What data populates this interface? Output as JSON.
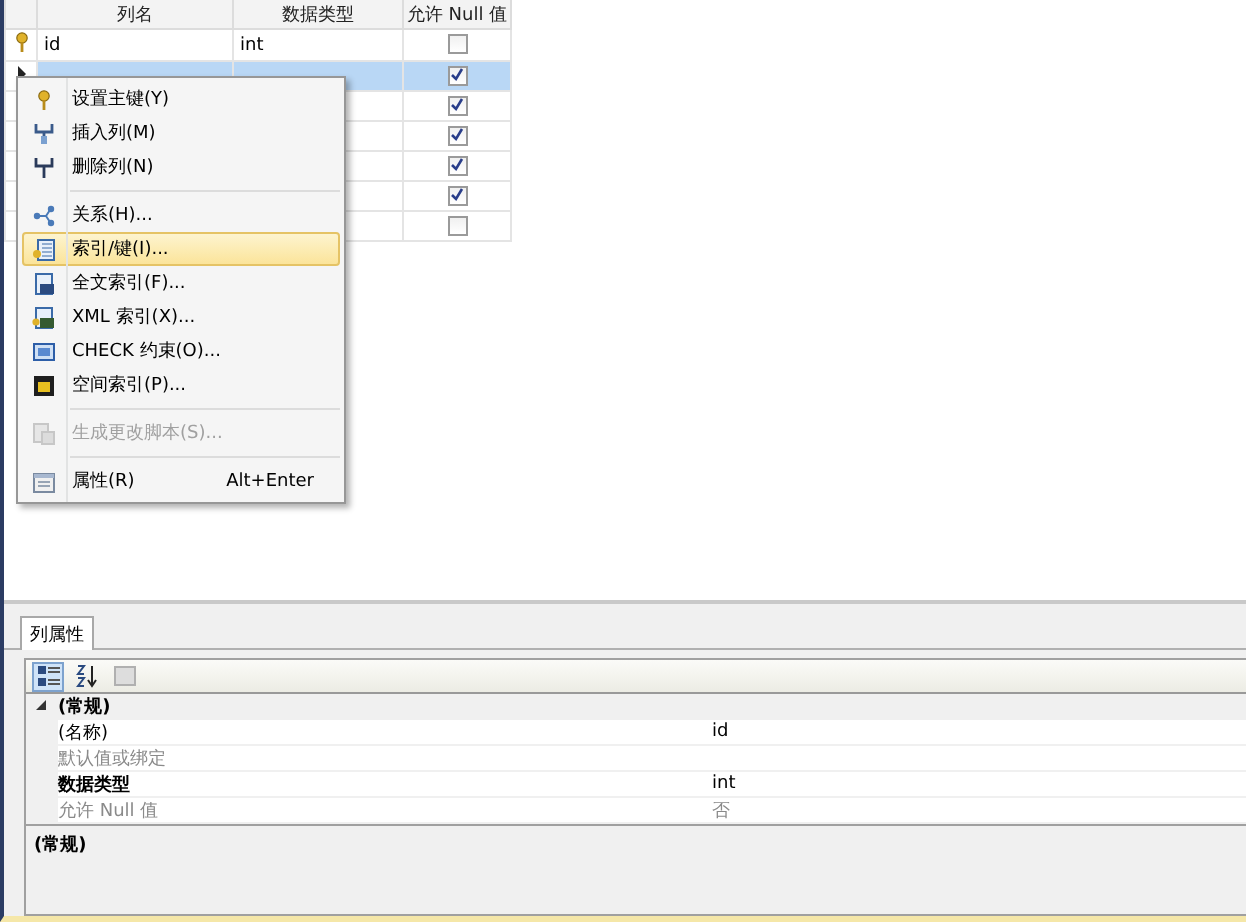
{
  "grid": {
    "columns": [
      "列名",
      "数据类型",
      "允许 Null 值"
    ],
    "rows": [
      {
        "name": "id",
        "type": "int",
        "allow_null": false,
        "selected": false,
        "primary_key": true,
        "current": false
      },
      {
        "allow_null": true,
        "selected": true,
        "primary_key": false,
        "current": true
      },
      {
        "allow_null": true,
        "selected": false,
        "primary_key": false,
        "current": false
      },
      {
        "allow_null": true,
        "selected": false,
        "primary_key": false,
        "current": false
      },
      {
        "allow_null": true,
        "selected": false,
        "primary_key": false,
        "current": false
      },
      {
        "allow_null": true,
        "selected": false,
        "primary_key": false,
        "current": false
      },
      {
        "allow_null": false,
        "selected": false,
        "primary_key": false,
        "current": false
      }
    ]
  },
  "context_menu": {
    "items": [
      {
        "kind": "item",
        "label": "设置主键(Y)",
        "disabled": false,
        "selected": false
      },
      {
        "kind": "item",
        "label": "插入列(M)",
        "disabled": false,
        "selected": false
      },
      {
        "kind": "item",
        "label": "删除列(N)",
        "disabled": false,
        "selected": false
      },
      {
        "kind": "separator"
      },
      {
        "kind": "item",
        "label": "关系(H)...",
        "disabled": false,
        "selected": false
      },
      {
        "kind": "item",
        "label": "索引/键(I)...",
        "disabled": false,
        "selected": true
      },
      {
        "kind": "item",
        "label": "全文索引(F)...",
        "disabled": false,
        "selected": false
      },
      {
        "kind": "item",
        "label": "XML 索引(X)...",
        "disabled": false,
        "selected": false
      },
      {
        "kind": "item",
        "label": "CHECK 约束(O)...",
        "disabled": false,
        "selected": false
      },
      {
        "kind": "item",
        "label": "空间索引(P)...",
        "disabled": false,
        "selected": false
      },
      {
        "kind": "separator"
      },
      {
        "kind": "item",
        "label": "生成更改脚本(S)...",
        "disabled": true,
        "selected": false
      },
      {
        "kind": "separator"
      },
      {
        "kind": "item",
        "label": "属性(R)",
        "shortcut": "Alt+Enter",
        "disabled": false,
        "selected": false
      }
    ]
  },
  "properties_panel": {
    "tab": "列属性",
    "category": {
      "label": "(常规)",
      "expanded": true
    },
    "rows": [
      {
        "name": "(名称)",
        "value": "id",
        "bold": false,
        "disabled": false
      },
      {
        "name": "默认值或绑定",
        "disabled": true,
        "bold": false
      },
      {
        "name": "数据类型",
        "value": "int",
        "bold": true,
        "disabled": false
      },
      {
        "name": "允许 Null 值",
        "value": "否",
        "bold": false,
        "disabled": true
      }
    ],
    "description": "(常规)"
  }
}
